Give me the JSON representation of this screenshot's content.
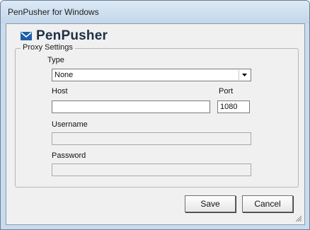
{
  "window": {
    "title": "PenPusher for Windows"
  },
  "brand": {
    "name": "PenPusher",
    "icon": "envelope-icon",
    "icon_color": "#1f5fa8"
  },
  "proxy": {
    "group_label": "Proxy Settings",
    "type_label": "Type",
    "type_value": "None",
    "host_label": "Host",
    "host_value": "",
    "port_label": "Port",
    "port_value": "1080",
    "username_label": "Username",
    "username_value": "",
    "password_label": "Password",
    "password_value": ""
  },
  "buttons": {
    "save": "Save",
    "cancel": "Cancel"
  }
}
